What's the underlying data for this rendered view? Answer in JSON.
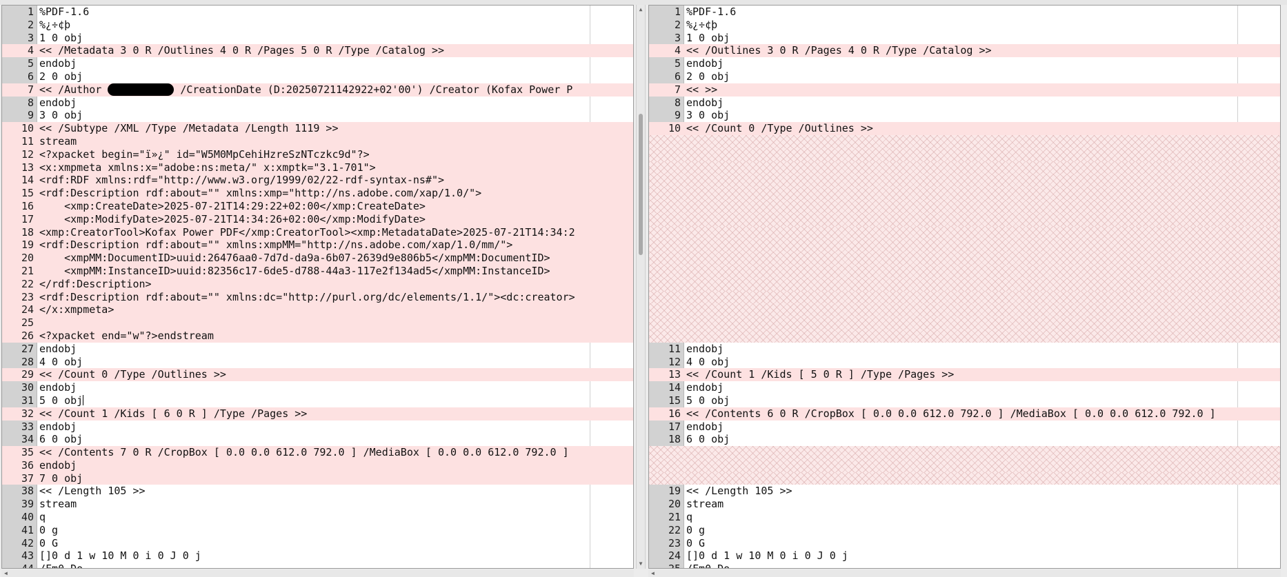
{
  "colors": {
    "changed": "#fde1e1",
    "gutter": "#d2d2d2",
    "filler": "#fbe9e9"
  },
  "left_pane": {
    "lines": [
      {
        "n": "1",
        "text": "%PDF-1.6",
        "changed": false
      },
      {
        "n": "2",
        "text": "%¿÷¢þ",
        "changed": false
      },
      {
        "n": "3",
        "text": "1 0 obj",
        "changed": false
      },
      {
        "n": "4",
        "text": "<< /Metadata 3 0 R /Outlines 4 0 R /Pages 5 0 R /Type /Catalog >>",
        "changed": true
      },
      {
        "n": "5",
        "text": "endobj",
        "changed": false
      },
      {
        "n": "6",
        "text": "2 0 obj",
        "changed": false
      },
      {
        "n": "7",
        "text": "<< /Author ",
        "after": " /CreationDate (D:20250721142922+02'00') /Creator (Kofax Power P",
        "redacted": true,
        "changed": true
      },
      {
        "n": "8",
        "text": "endobj",
        "changed": false
      },
      {
        "n": "9",
        "text": "3 0 obj",
        "changed": false
      },
      {
        "n": "10",
        "text": "<< /Subtype /XML /Type /Metadata /Length 1119 >>",
        "changed": true
      },
      {
        "n": "11",
        "text": "stream",
        "changed": true
      },
      {
        "n": "12",
        "text": "<?xpacket begin=\"ï»¿\" id=\"W5M0MpCehiHzreSzNTczkc9d\"?>",
        "changed": true
      },
      {
        "n": "13",
        "text": "<x:xmpmeta xmlns:x=\"adobe:ns:meta/\" x:xmptk=\"3.1-701\">",
        "changed": true
      },
      {
        "n": "14",
        "text": "<rdf:RDF xmlns:rdf=\"http://www.w3.org/1999/02/22-rdf-syntax-ns#\">",
        "changed": true
      },
      {
        "n": "15",
        "text": "<rdf:Description rdf:about=\"\" xmlns:xmp=\"http://ns.adobe.com/xap/1.0/\">",
        "changed": true
      },
      {
        "n": "16",
        "text": "    <xmp:CreateDate>2025-07-21T14:29:22+02:00</xmp:CreateDate>",
        "changed": true
      },
      {
        "n": "17",
        "text": "    <xmp:ModifyDate>2025-07-21T14:34:26+02:00</xmp:ModifyDate>",
        "changed": true
      },
      {
        "n": "18",
        "text": "<xmp:CreatorTool>Kofax Power PDF</xmp:CreatorTool><xmp:MetadataDate>2025-07-21T14:34:2",
        "changed": true
      },
      {
        "n": "19",
        "text": "<rdf:Description rdf:about=\"\" xmlns:xmpMM=\"http://ns.adobe.com/xap/1.0/mm/\">",
        "changed": true
      },
      {
        "n": "20",
        "text": "    <xmpMM:DocumentID>uuid:26476aa0-7d7d-da9a-6b07-2639d9e806b5</xmpMM:DocumentID>",
        "changed": true
      },
      {
        "n": "21",
        "text": "    <xmpMM:InstanceID>uuid:82356c17-6de5-d788-44a3-117e2f134ad5</xmpMM:InstanceID>",
        "changed": true
      },
      {
        "n": "22",
        "text": "</rdf:Description>",
        "changed": true
      },
      {
        "n": "23",
        "text": "<rdf:Description rdf:about=\"\" xmlns:dc=\"http://purl.org/dc/elements/1.1/\"><dc:creator>",
        "changed": true
      },
      {
        "n": "24",
        "text": "</x:xmpmeta>",
        "changed": true
      },
      {
        "n": "25",
        "text": "",
        "changed": true
      },
      {
        "n": "26",
        "text": "<?xpacket end=\"w\"?>endstream",
        "changed": true
      },
      {
        "n": "27",
        "text": "endobj",
        "changed": false
      },
      {
        "n": "28",
        "text": "4 0 obj",
        "changed": false
      },
      {
        "n": "29",
        "text": "<< /Count 0 /Type /Outlines >>",
        "changed": true
      },
      {
        "n": "30",
        "text": "endobj",
        "changed": false
      },
      {
        "n": "31",
        "text": "5 0 obj",
        "caret": true,
        "changed": false
      },
      {
        "n": "32",
        "text": "<< /Count 1 /Kids [ 6 0 R ] /Type /Pages >>",
        "changed": true
      },
      {
        "n": "33",
        "text": "endobj",
        "changed": false
      },
      {
        "n": "34",
        "text": "6 0 obj",
        "changed": false
      },
      {
        "n": "35",
        "text": "<< /Contents 7 0 R /CropBox [ 0.0 0.0 612.0 792.0 ] /MediaBox [ 0.0 0.0 612.0 792.0 ]",
        "changed": true
      },
      {
        "n": "36",
        "text": "endobj",
        "changed": true
      },
      {
        "n": "37",
        "text": "7 0 obj",
        "changed": true
      },
      {
        "n": "38",
        "text": "<< /Length 105 >>",
        "changed": false
      },
      {
        "n": "39",
        "text": "stream",
        "changed": false
      },
      {
        "n": "40",
        "text": "q",
        "changed": false
      },
      {
        "n": "41",
        "text": "0 g",
        "changed": false
      },
      {
        "n": "42",
        "text": "0 G",
        "changed": false
      },
      {
        "n": "43",
        "text": "[]0 d 1 w 10 M 0 i 0 J 0 j",
        "changed": false
      },
      {
        "n": "44",
        "text": "/Fm0 Do",
        "changed": false
      }
    ]
  },
  "right_pane": {
    "lines": [
      {
        "n": "1",
        "text": "%PDF-1.6",
        "changed": false
      },
      {
        "n": "2",
        "text": "%¿÷¢þ",
        "changed": false
      },
      {
        "n": "3",
        "text": "1 0 obj",
        "changed": false
      },
      {
        "n": "4",
        "text": "<< /Outlines 3 0 R /Pages 4 0 R /Type /Catalog >>",
        "changed": true
      },
      {
        "n": "5",
        "text": "endobj",
        "changed": false
      },
      {
        "n": "6",
        "text": "2 0 obj",
        "changed": false
      },
      {
        "n": "7",
        "text": "<< >>",
        "changed": true
      },
      {
        "n": "8",
        "text": "endobj",
        "changed": false
      },
      {
        "n": "9",
        "text": "3 0 obj",
        "changed": false
      },
      {
        "n": "10",
        "text": "<< /Count 0 /Type /Outlines >>",
        "changed": true
      },
      {
        "filler": true
      },
      {
        "filler": true
      },
      {
        "filler": true
      },
      {
        "filler": true
      },
      {
        "filler": true
      },
      {
        "filler": true
      },
      {
        "filler": true
      },
      {
        "filler": true
      },
      {
        "filler": true
      },
      {
        "filler": true
      },
      {
        "filler": true
      },
      {
        "filler": true
      },
      {
        "filler": true
      },
      {
        "filler": true
      },
      {
        "filler": true
      },
      {
        "filler": true
      },
      {
        "n": "11",
        "text": "endobj",
        "changed": false
      },
      {
        "n": "12",
        "text": "4 0 obj",
        "changed": false
      },
      {
        "n": "13",
        "text": "<< /Count 1 /Kids [ 5 0 R ] /Type /Pages >>",
        "changed": true
      },
      {
        "n": "14",
        "text": "endobj",
        "changed": false
      },
      {
        "n": "15",
        "text": "5 0 obj",
        "changed": false
      },
      {
        "n": "16",
        "text": "<< /Contents 6 0 R /CropBox [ 0.0 0.0 612.0 792.0 ] /MediaBox [ 0.0 0.0 612.0 792.0 ]",
        "changed": true
      },
      {
        "n": "17",
        "text": "endobj",
        "changed": false
      },
      {
        "n": "18",
        "text": "6 0 obj",
        "changed": false
      },
      {
        "filler": true
      },
      {
        "filler": true
      },
      {
        "filler": true
      },
      {
        "n": "19",
        "text": "<< /Length 105 >>",
        "changed": false
      },
      {
        "n": "20",
        "text": "stream",
        "changed": false
      },
      {
        "n": "21",
        "text": "q",
        "changed": false
      },
      {
        "n": "22",
        "text": "0 g",
        "changed": false
      },
      {
        "n": "23",
        "text": "0 G",
        "changed": false
      },
      {
        "n": "24",
        "text": "[]0 d 1 w 10 M 0 i 0 J 0 j",
        "changed": false
      },
      {
        "n": "25",
        "text": "/Fm0 Do",
        "changed": false
      }
    ]
  }
}
